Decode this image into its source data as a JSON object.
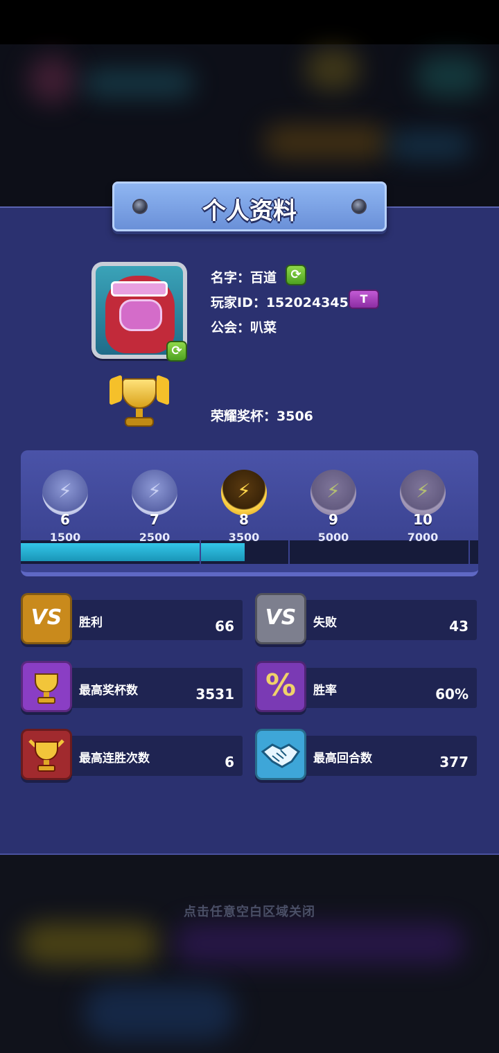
{
  "title": "个人资料",
  "profile": {
    "name_line": "名字：百道",
    "id_line": "玩家ID：152024345",
    "id_tag": "T",
    "guild_line": "公会：叭菜",
    "trophy_line": "荣耀奖杯：3506"
  },
  "icons": {
    "swap": "⟳",
    "bolt": "⚡",
    "vs": "VS",
    "percent": "%"
  },
  "ranks": [
    {
      "level": "6",
      "trophies": "1500",
      "tier": "silver"
    },
    {
      "level": "7",
      "trophies": "2500",
      "tier": "silver"
    },
    {
      "level": "8",
      "trophies": "3500",
      "tier": "gold"
    },
    {
      "level": "9",
      "trophies": "5000",
      "tier": "bronze"
    },
    {
      "level": "10",
      "trophies": "7000",
      "tier": "bronze"
    }
  ],
  "progress_fraction": 0.49,
  "stats": [
    {
      "label": "胜利",
      "value": "66",
      "color": "#c98a1c"
    },
    {
      "label": "失败",
      "value": "43",
      "color": "#7d7f8e"
    },
    {
      "label": "最高奖杯数",
      "value": "3531",
      "color": "#8a3ec4"
    },
    {
      "label": "胜率",
      "value": "60%",
      "color": "#7a3ab4"
    },
    {
      "label": "最高连胜次数",
      "value": "6",
      "color": "#a12a2e"
    },
    {
      "label": "最高回合数",
      "value": "377",
      "color": "#3ea6d8"
    }
  ],
  "close_hint": "点击任意空白区域关闭"
}
